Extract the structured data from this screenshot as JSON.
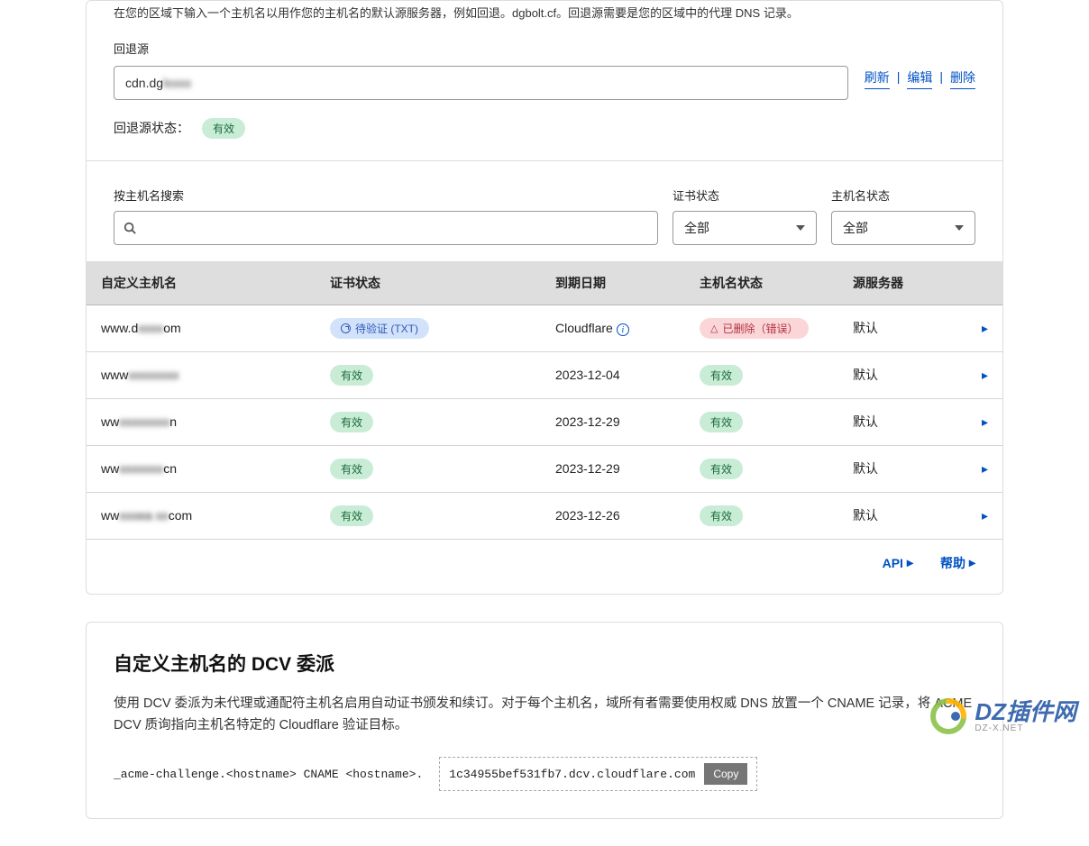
{
  "fallback": {
    "description": "在您的区域下输入一个主机名以用作您的主机名的默认源服务器，例如回退。dgbolt.cf。回退源需要是您的区域中的代理 DNS 记录。",
    "label": "回退源",
    "value_prefix": "cdn.dg",
    "value_blur": "lxxxx",
    "actions": {
      "refresh": "刷新",
      "edit": "编辑",
      "delete": "删除"
    },
    "status_label": "回退源状态：",
    "status_value": "有效"
  },
  "filters": {
    "search_label": "按主机名搜索",
    "cert_label": "证书状态",
    "cert_value": "全部",
    "host_label": "主机名状态",
    "host_value": "全部"
  },
  "table": {
    "headers": {
      "host": "自定义主机名",
      "cert": "证书状态",
      "expiry": "到期日期",
      "host_status": "主机名状态",
      "origin": "源服务器"
    },
    "rows": [
      {
        "host_pre": "www.d",
        "host_blur": "xxxx",
        "host_post": "om",
        "cert_type": "blue",
        "cert_text": "待验证 (TXT)",
        "expiry": "Cloudflare",
        "expiry_info": true,
        "host_status_type": "red",
        "host_status_text": "已删除（错误）",
        "origin": "默认"
      },
      {
        "host_pre": "www",
        "host_blur": "xxxxxxxx",
        "host_post": "",
        "cert_type": "green",
        "cert_text": "有效",
        "expiry": "2023-12-04",
        "expiry_info": false,
        "host_status_type": "green",
        "host_status_text": "有效",
        "origin": "默认"
      },
      {
        "host_pre": "ww",
        "host_blur": "xxxxxxxx",
        "host_post": "n",
        "cert_type": "green",
        "cert_text": "有效",
        "expiry": "2023-12-29",
        "expiry_info": false,
        "host_status_type": "green",
        "host_status_text": "有效",
        "origin": "默认"
      },
      {
        "host_pre": "ww",
        "host_blur": "xxxxxxx",
        "host_post": "cn",
        "cert_type": "green",
        "cert_text": "有效",
        "expiry": "2023-12-29",
        "expiry_info": false,
        "host_status_type": "green",
        "host_status_text": "有效",
        "origin": "默认"
      },
      {
        "host_pre": "ww",
        "host_blur": "xxxea xx",
        "host_post": "com",
        "cert_type": "green",
        "cert_text": "有效",
        "expiry": "2023-12-26",
        "expiry_info": false,
        "host_status_type": "green",
        "host_status_text": "有效",
        "origin": "默认"
      }
    ]
  },
  "footer": {
    "api": "API",
    "help": "帮助"
  },
  "dcv": {
    "title": "自定义主机名的 DCV 委派",
    "desc": "使用 DCV 委派为未代理或通配符主机名启用自动证书颁发和续订。对于每个主机名，域所有者需要使用权威 DNS 放置一个 CNAME 记录，将 ACME DCV 质询指向主机名特定的 Cloudflare 验证目标。",
    "record_left": "_acme-challenge.<hostname> CNAME <hostname>.",
    "record_right": "1c34955bef531fb7.dcv.cloudflare.com",
    "copy": "Copy"
  },
  "watermark": {
    "text": "DZ插件网",
    "sub": "DZ-X.NET"
  }
}
